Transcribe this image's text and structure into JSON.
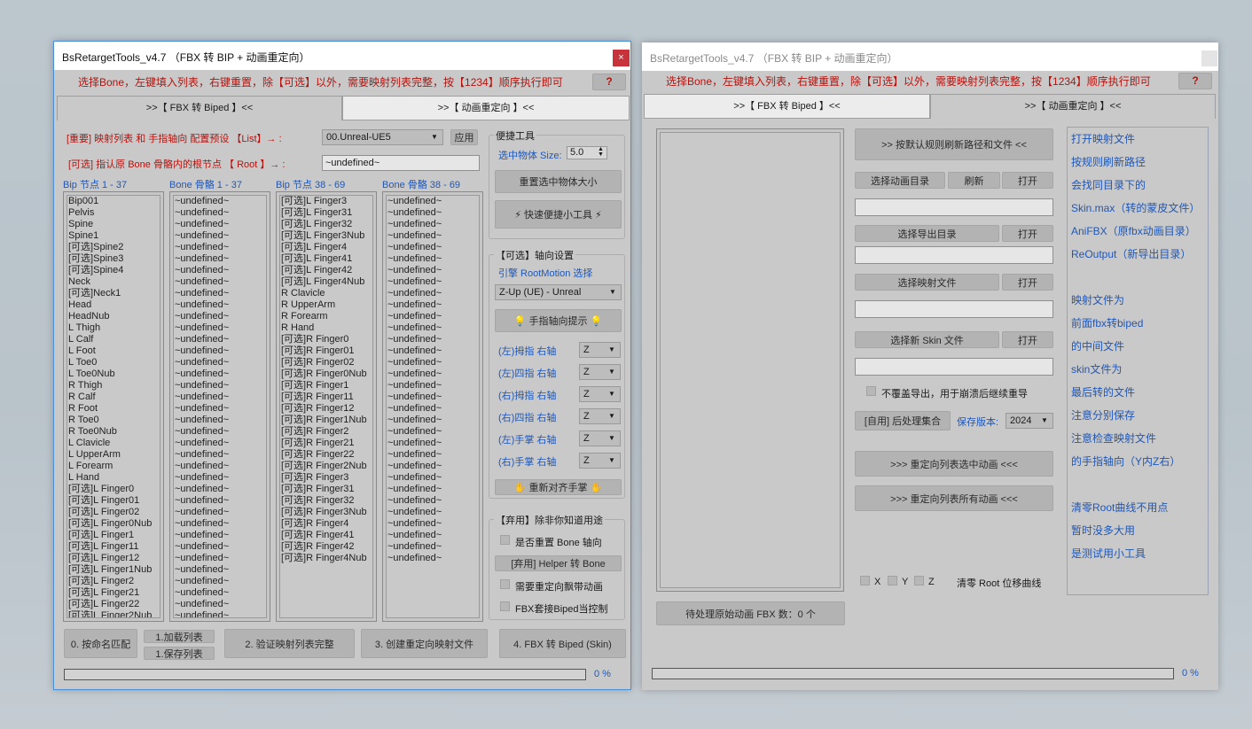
{
  "left": {
    "title": "BsRetargetTools_v4.7 （FBX 转 BIP + 动画重定向）",
    "close": "×",
    "hint": "选择Bone，左键填入列表，右键重置，除【可选】以外，需要映射列表完整，按【1234】顺序执行即可",
    "help": "?",
    "tabs": [
      ">>【 FBX 转 Biped 】<<",
      ">>【 动画重定向 】<<"
    ],
    "preset_label": "[重要] 映射列表 和 手指轴向 配置预设 【List】→ :",
    "preset_value": "00.Unreal-UE5",
    "apply": "应用",
    "root_label": "[可选] 指认原 Bone 骨骼内的根节点 【 Root 】→ :",
    "root_value": "~undefined~",
    "col_headers": [
      "Bip 节点 1 - 37",
      "Bone 骨骼 1 - 37",
      "Bip 节点 38 - 69",
      "Bone 骨骼 38 - 69"
    ],
    "bip1": [
      "Bip001",
      "Pelvis",
      "Spine",
      "Spine1",
      "[可选]Spine2",
      "[可选]Spine3",
      "[可选]Spine4",
      "Neck",
      "[可选]Neck1",
      "Head",
      "HeadNub",
      "L Thigh",
      "L Calf",
      "L Foot",
      "L Toe0",
      "L Toe0Nub",
      "R Thigh",
      "R Calf",
      "R Foot",
      "R Toe0",
      "R Toe0Nub",
      "L Clavicle",
      "L UpperArm",
      "L Forearm",
      "L Hand",
      "[可选]L Finger0",
      "[可选]L Finger01",
      "[可选]L Finger02",
      "[可选]L Finger0Nub",
      "[可选]L Finger1",
      "[可选]L Finger11",
      "[可选]L Finger12",
      "[可选]L Finger1Nub",
      "[可选]L Finger2",
      "[可选]L Finger21",
      "[可选]L Finger22",
      "[可选]L Finger2Nub"
    ],
    "bip2": [
      "[可选]L Finger3",
      "[可选]L Finger31",
      "[可选]L Finger32",
      "[可选]L Finger3Nub",
      "[可选]L Finger4",
      "[可选]L Finger41",
      "[可选]L Finger42",
      "[可选]L Finger4Nub",
      "R Clavicle",
      "R UpperArm",
      "R Forearm",
      "R Hand",
      "[可选]R Finger0",
      "[可选]R Finger01",
      "[可选]R Finger02",
      "[可选]R Finger0Nub",
      "[可选]R Finger1",
      "[可选]R Finger11",
      "[可选]R Finger12",
      "[可选]R Finger1Nub",
      "[可选]R Finger2",
      "[可选]R Finger21",
      "[可选]R Finger22",
      "[可选]R Finger2Nub",
      "[可选]R Finger3",
      "[可选]R Finger31",
      "[可选]R Finger32",
      "[可选]R Finger3Nub",
      "[可选]R Finger4",
      "[可选]R Finger41",
      "[可选]R Finger42",
      "[可选]R Finger4Nub"
    ],
    "undef": "~undefined~",
    "bone1_count": 37,
    "bone2_count": 32,
    "tools_title": "便捷工具",
    "size_label": "选中物体 Size:",
    "size_value": "5.0",
    "reset_size": "重置选中物体大小",
    "quick_tools": "⚡ 快速便捷小工具 ⚡",
    "axis_title": "【可选】轴向设置",
    "engine_label": "引擎 RootMotion 选择",
    "engine_value": "Z-Up (UE)  - Unreal",
    "finger_hint": "💡 手指轴向提示 💡",
    "axes": [
      {
        "label": "(左)拇指 右轴",
        "value": "Z"
      },
      {
        "label": "(左)四指 右轴",
        "value": "Z"
      },
      {
        "label": "(右)拇指 右轴",
        "value": "Z"
      },
      {
        "label": "(右)四指 右轴",
        "value": "Z"
      },
      {
        "label": "(左)手掌 右轴",
        "value": "Z"
      },
      {
        "label": "(右)手掌 右轴",
        "value": "Z"
      }
    ],
    "realign": "✋ 重新对齐手掌 ✋",
    "abandon_title": "【弃用】除非你知道用途",
    "cb_reset_bone": "是否重置 Bone 轴向",
    "helper_btn": "[弃用] Helper 转 Bone",
    "cb_retarget_anim": "需要重定向飘带动画",
    "cb_fbx_overwrite": "FBX套接Biped当控制",
    "step0": "0. 按命名匹配",
    "load_list": "1.加载列表",
    "save_list": "1.保存列表",
    "step2": "2. 验证映射列表完整",
    "step3": "3. 创建重定向映射文件",
    "step4": "4. FBX 转 Biped (Skin)",
    "progress_pct": "0 %",
    "progress": 0
  },
  "right": {
    "title": "BsRetargetTools_v4.7 （FBX 转 BIP + 动画重定向）",
    "hint": "选择Bone，左键填入列表，右键重置，除【可选】以外，需要映射列表完整，按【1234】顺序执行即可",
    "help": "?",
    "tabs": [
      ">>【 FBX 转 Biped 】<<",
      ">>【 动画重定向 】<<"
    ],
    "refresh_default": ">> 按默认规则刷新路径和文件 <<",
    "select_anim_dir": "选择动画目录",
    "refresh": "刷新",
    "open": "打开",
    "select_export_dir": "选择导出目录",
    "select_map_file": "选择映射文件",
    "select_skin_file": "选择新 Skin 文件",
    "no_overwrite": "不覆盖导出，用于崩溃后继续重导",
    "self_use": "[自用] 后处理集合",
    "save_version_label": "保存版本:",
    "save_version": "2024",
    "retarget_selected": ">>>  重定向列表选中动画  <<<",
    "retarget_all": ">>>  重定向列表所有动画  <<<",
    "axis_x": "X",
    "axis_y": "Y",
    "axis_z": "Z",
    "clear_root": "清零 Root 位移曲线",
    "pending": "待处理原始动画 FBX 数：0 个",
    "progress_pct": "0 %",
    "progress": 0,
    "links": [
      "打开映射文件",
      "按规则刷新路径",
      "会找同目录下的",
      "Skin.max（转的蒙皮文件）",
      "AniFBX（原fbx动画目录）",
      "ReOutput（新导出目录）",
      "",
      "映射文件为",
      "前面fbx转biped",
      "的中间文件",
      "skin文件为",
      "最后转的文件",
      "注意分别保存",
      "注意检查映射文件",
      "的手指轴向（Y内Z右）",
      "",
      "清零Root曲线不用点",
      "暂时没多大用",
      "是测试用小工具"
    ]
  }
}
